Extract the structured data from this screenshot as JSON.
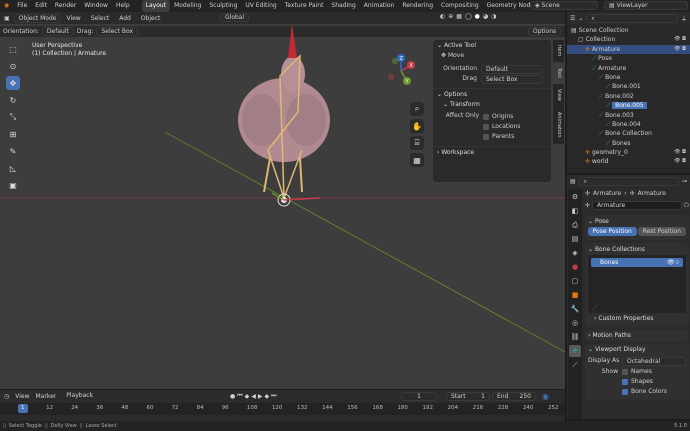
{
  "menu": {
    "items": [
      "File",
      "Edit",
      "Render",
      "Window",
      "Help"
    ]
  },
  "workspaces": [
    "Layout",
    "Modeling",
    "Sculpting",
    "UV Editing",
    "Texture Paint",
    "Shading",
    "Animation",
    "Rendering",
    "Compositing",
    "Geometry Nodes",
    "Scripting"
  ],
  "active_workspace": "Layout",
  "scene_label": "Scene",
  "view_layer_label": "ViewLayer",
  "viewport": {
    "mode": "Object Mode",
    "menus": [
      "View",
      "Select",
      "Add",
      "Object"
    ],
    "transform_orientation": "Global",
    "orientation_label": "Orientation:",
    "orientation_value": "Default",
    "drag_label": "Drag:",
    "drag_value": "Select Box",
    "options_label": "Options",
    "info_line1": "User Perspective",
    "info_line2": "(1) Collection | Armature",
    "gizmo": {
      "x": "X",
      "y": "Y",
      "z": "Z"
    }
  },
  "n_panel": {
    "tabs": [
      "Item",
      "Tool",
      "View",
      "Animation"
    ],
    "active_tool_title": "Active Tool",
    "tool_name": "Move",
    "orientation_label": "Orientation",
    "orientation_value": "Default",
    "drag_label": "Drag",
    "drag_value": "Select Box",
    "options_title": "Options",
    "transform_title": "Transform",
    "affect_only_label": "Affect Only",
    "affect_options": [
      "Origins",
      "Locations",
      "Parents"
    ],
    "workspace_title": "Workspace"
  },
  "outliner": {
    "search_placeholder": "",
    "rows": [
      {
        "label": "Scene Collection",
        "indent": 0
      },
      {
        "label": "Collection",
        "indent": 1
      },
      {
        "label": "Armature",
        "indent": 2,
        "selected": true
      },
      {
        "label": "Pose",
        "indent": 3
      },
      {
        "label": "Armature",
        "indent": 3
      },
      {
        "label": "Bone",
        "indent": 4
      },
      {
        "label": "Bone.001",
        "indent": 5
      },
      {
        "label": "Bone.002",
        "indent": 4
      },
      {
        "label": "Bone.005",
        "indent": 5,
        "active": true
      },
      {
        "label": "Bone.003",
        "indent": 4
      },
      {
        "label": "Bone.004",
        "indent": 5
      },
      {
        "label": "Bone Collection",
        "indent": 4
      },
      {
        "label": "Bones",
        "indent": 5
      },
      {
        "label": "geometry_0",
        "indent": 2
      },
      {
        "label": "world",
        "indent": 2
      }
    ]
  },
  "properties": {
    "breadcrumb_1": "Armature",
    "breadcrumb_2": "Armature",
    "name_field": "Armature",
    "pose_title": "Pose",
    "pose_position": "Pose Position",
    "rest_position": "Rest Position",
    "bone_collections_title": "Bone Collections",
    "bone_collection_item": "Bones",
    "custom_properties": "Custom Properties",
    "motion_paths": "Motion Paths",
    "viewport_display": "Viewport Display",
    "display_as_label": "Display As",
    "display_as_value": "Octahedral",
    "show_label": "Show",
    "show_names": "Names",
    "show_shapes": "Shapes",
    "show_bone_colors": "Bone Colors"
  },
  "timeline": {
    "menus": [
      "View",
      "Marker",
      "Playback"
    ],
    "current_frame": "1",
    "start_label": "Start",
    "start_value": "1",
    "end_label": "End",
    "end_value": "250",
    "ticks": [
      "1",
      "12",
      "24",
      "36",
      "48",
      "60",
      "72",
      "84",
      "96",
      "108",
      "120",
      "132",
      "144",
      "156",
      "168",
      "180",
      "192",
      "204",
      "216",
      "228",
      "240",
      "252"
    ]
  },
  "statusbar": {
    "hint1": "Select Toggle",
    "hint2": "Dolly View",
    "hint3": "Lasso Select",
    "version": "5.1.0"
  },
  "colors": {
    "accent": "#4772b3",
    "selection": "#334d80",
    "x_axis": "#c43c4a",
    "y_axis": "#6e9a2a",
    "z_axis": "#2d6cc7",
    "bone": "#e0b873"
  }
}
